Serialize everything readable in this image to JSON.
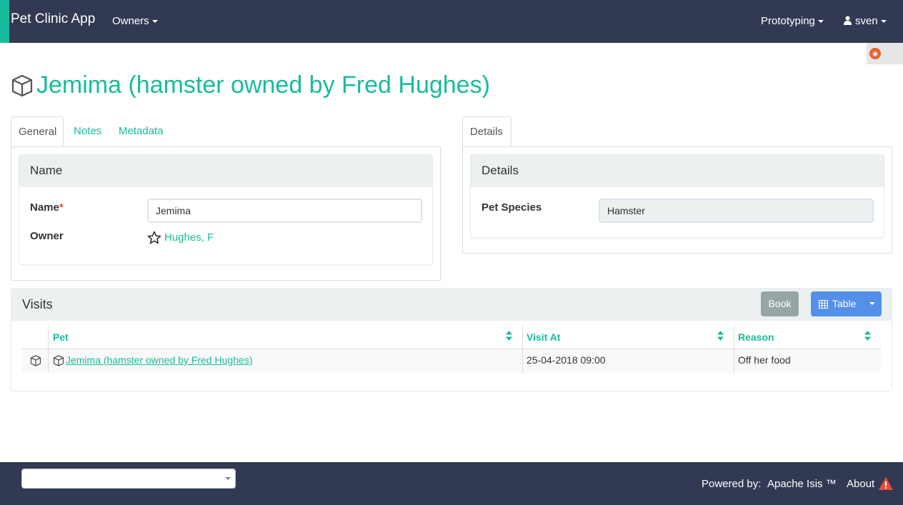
{
  "navbar": {
    "brand": "Pet Clinic App",
    "owners_menu": "Owners",
    "prototyping_menu": "Prototyping",
    "user_menu": "sven"
  },
  "colors": {
    "accent": "#18bc9c",
    "navbar": "#323a53",
    "primary_button": "#5490e8",
    "secondary_button": "#95a5a6"
  },
  "title": "Jemima (hamster owned by Fred Hughes)",
  "left_tabs": [
    {
      "label": "General",
      "active": true
    },
    {
      "label": "Notes",
      "active": false
    },
    {
      "label": "Metadata",
      "active": false
    }
  ],
  "name_panel": {
    "heading": "Name",
    "name_label": "Name",
    "required_marker": "*",
    "name_value": "Jemima",
    "owner_label": "Owner",
    "owner_value": "Hughes, F",
    "owner_icon": "star-outline-icon"
  },
  "right_tabs": [
    {
      "label": "Details",
      "active": true
    }
  ],
  "details_panel": {
    "heading": "Details",
    "species_label": "Pet Species",
    "species_value": "Hamster"
  },
  "visits": {
    "heading": "Visits",
    "book_button": "Book",
    "table_button": "Table",
    "columns": [
      "Pet",
      "Visit At",
      "Reason"
    ],
    "rows": [
      {
        "pet": "Jemima (hamster owned by Fred Hughes)",
        "visit_at": "25-04-2018 09:00",
        "reason": "Off her food"
      }
    ]
  },
  "footer": {
    "select_value": "",
    "powered_by": "Powered by:",
    "isis": "Apache Isis ™",
    "about": "About"
  }
}
